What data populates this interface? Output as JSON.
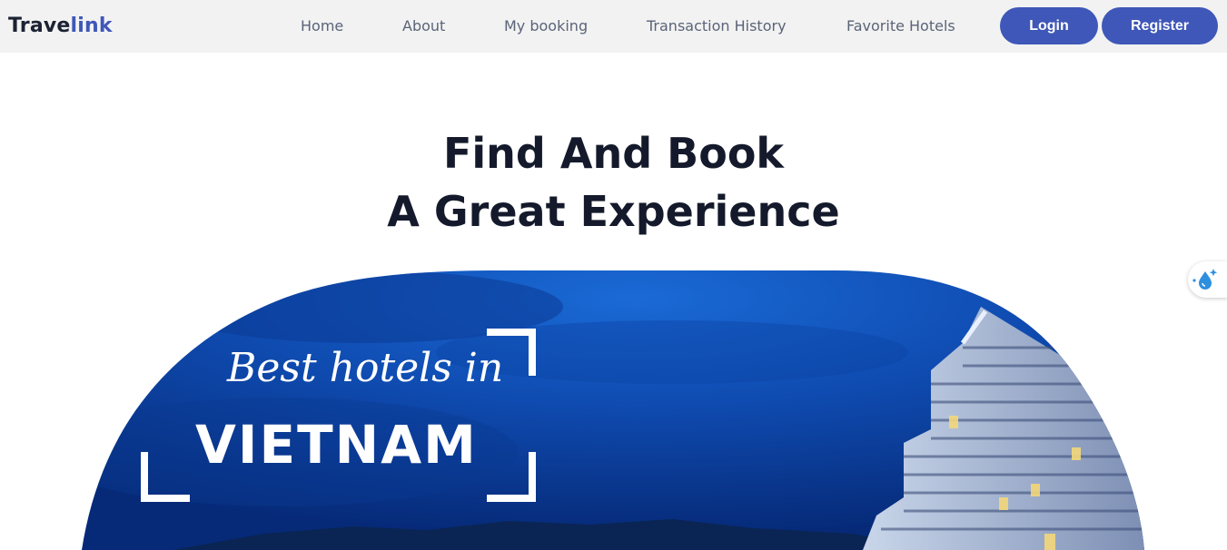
{
  "brand": {
    "part1": "Trave",
    "part2": "link"
  },
  "nav": {
    "items": [
      {
        "label": "Home"
      },
      {
        "label": "About"
      },
      {
        "label": "My booking"
      },
      {
        "label": "Transaction History"
      },
      {
        "label": "Favorite Hotels"
      }
    ],
    "login_label": "Login",
    "register_label": "Register"
  },
  "hero": {
    "line1": "Find And Book",
    "line2": "A Great Experience"
  },
  "banner": {
    "script_text": "Best hotels in",
    "country_text": "VIETNAM"
  },
  "widget": {
    "icon": "water-drop-sparkle-icon"
  },
  "colors": {
    "accent": "#3f57b8",
    "navbar_bg": "#f2f2f2",
    "heading": "#141a2b",
    "nav_text": "#5a6478"
  }
}
